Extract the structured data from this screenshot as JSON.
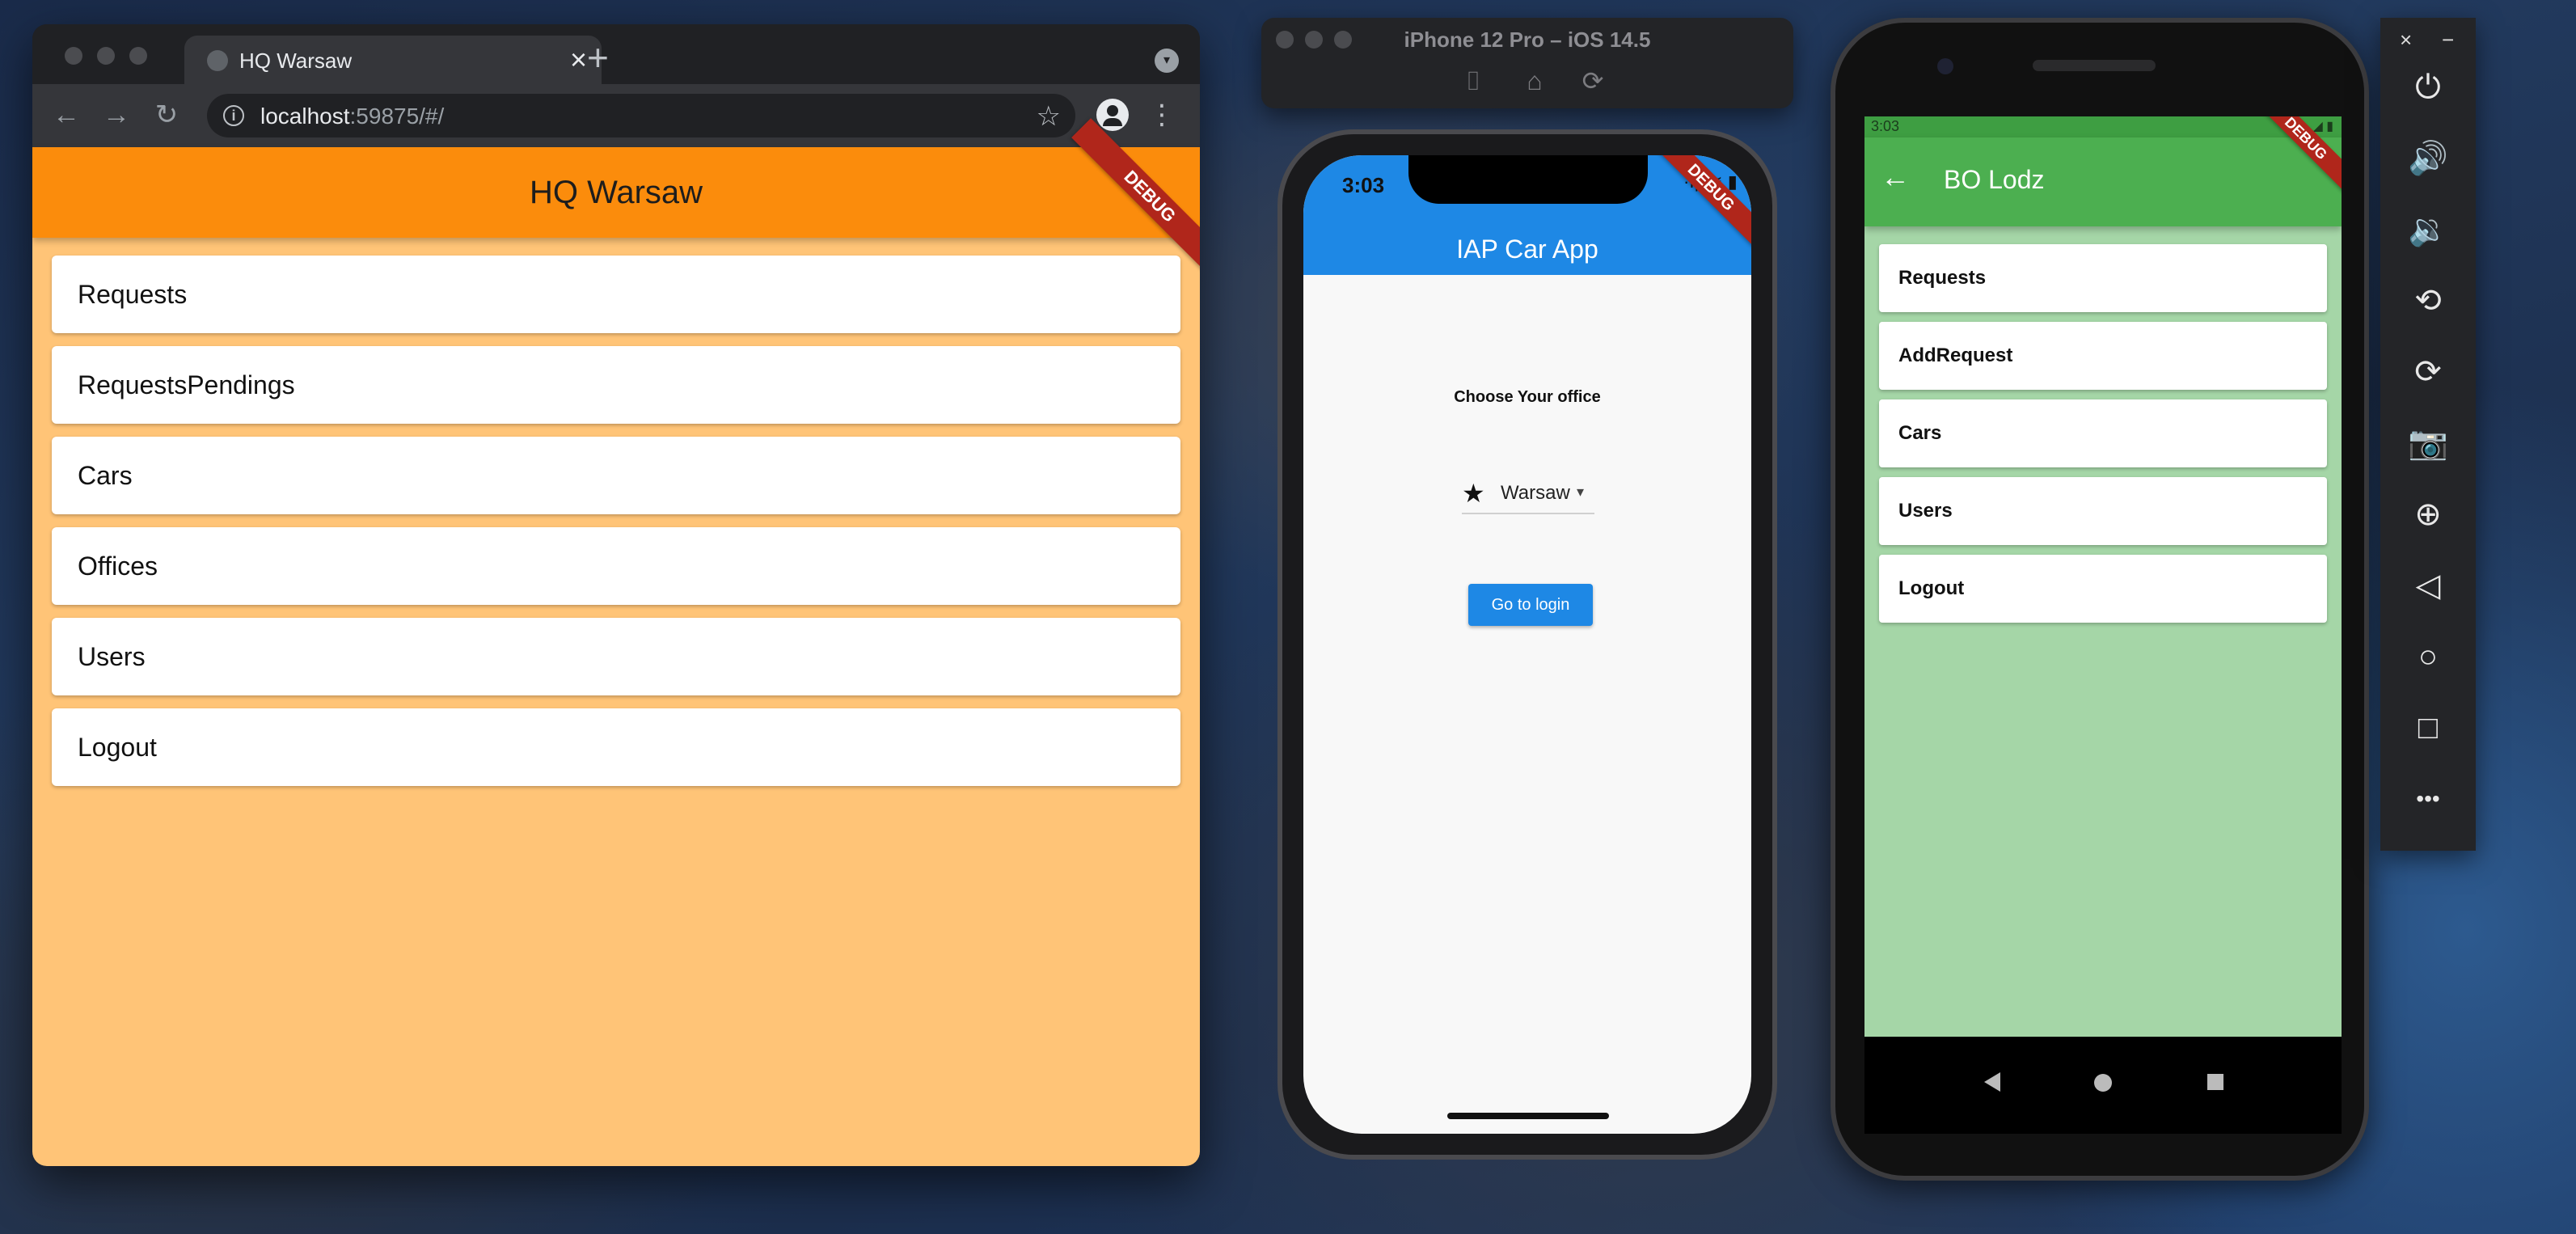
{
  "browser": {
    "tab_title": "HQ Warsaw",
    "tab_close": "×",
    "new_tab": "+",
    "url_host": "localhost",
    "url_rest": ":59875/#/",
    "back": "←",
    "forward": "→",
    "reload": "↻",
    "info": "i",
    "star": "☆",
    "menu": "⋮",
    "tab_menu": "▾"
  },
  "web_app": {
    "title": "HQ Warsaw",
    "debug_banner": "DEBUG",
    "accent": "#fb8c0c",
    "background": "#ffc477",
    "items": [
      {
        "label": "Requests"
      },
      {
        "label": "RequestsPendings"
      },
      {
        "label": "Cars"
      },
      {
        "label": "Offices"
      },
      {
        "label": "Users"
      },
      {
        "label": "Logout"
      }
    ]
  },
  "ios_simulator": {
    "window_title": "iPhone 12 Pro – iOS 14.5",
    "toolbar_icons": [
      "screenshot-icon",
      "home-icon",
      "rotate-icon"
    ],
    "status_time": "3:03",
    "status_icons": "·ı|l ≋ ▮",
    "app_title": "IAP Car App",
    "debug_banner": "DEBUG",
    "accent": "#1e88e5",
    "choose_label": "Choose Your office",
    "dropdown_icon": "★",
    "dropdown_value": "Warsaw",
    "dropdown_caret": "▾",
    "login_button": "Go to login"
  },
  "android_emulator": {
    "status_time": "3:03",
    "status_icons": "◢ ▮",
    "back_arrow": "←",
    "app_title": "BO Lodz",
    "debug_banner": "DEBUG",
    "accent": "#4caf50",
    "background": "#a5d6a7",
    "items": [
      {
        "label": "Requests"
      },
      {
        "label": "AddRequest"
      },
      {
        "label": "Cars"
      },
      {
        "label": "Users"
      },
      {
        "label": "Logout"
      }
    ]
  },
  "emulator_panel": {
    "close": "×",
    "minimize": "−",
    "buttons": [
      {
        "icon": "power-icon",
        "glyph": "⏻"
      },
      {
        "icon": "volume-up-icon",
        "glyph": "🔊"
      },
      {
        "icon": "volume-down-icon",
        "glyph": "🔉"
      },
      {
        "icon": "rotate-left-icon",
        "glyph": "⟲"
      },
      {
        "icon": "rotate-right-icon",
        "glyph": "⟳"
      },
      {
        "icon": "camera-icon",
        "glyph": "📷"
      },
      {
        "icon": "zoom-icon",
        "glyph": "⊕"
      },
      {
        "icon": "back-icon",
        "glyph": "◁"
      },
      {
        "icon": "home-icon",
        "glyph": "○"
      },
      {
        "icon": "overview-icon",
        "glyph": "□"
      },
      {
        "icon": "more-icon",
        "glyph": "•••"
      }
    ]
  }
}
